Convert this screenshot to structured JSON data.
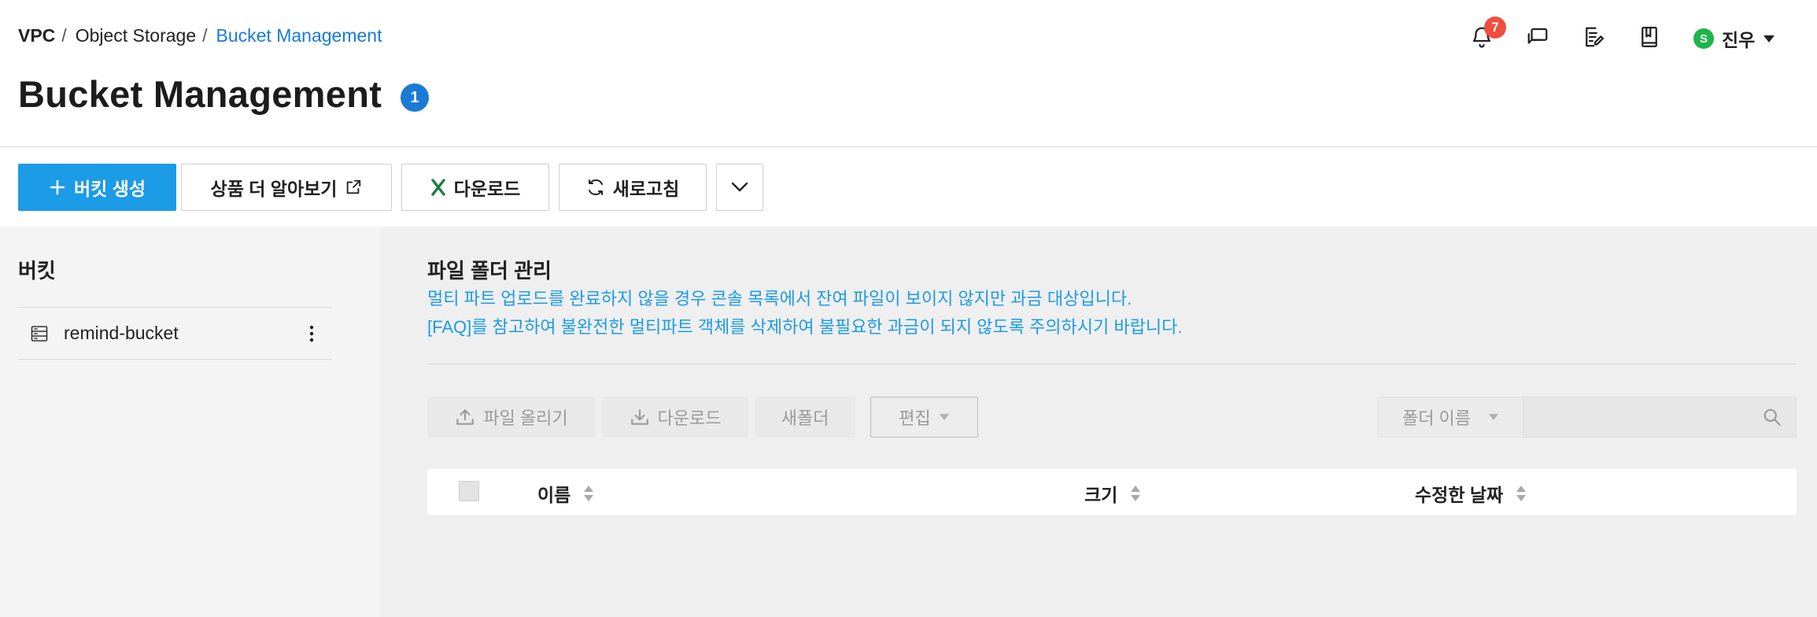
{
  "breadcrumb": {
    "items": [
      "VPC",
      "Object Storage"
    ],
    "separator": "/",
    "current": "Bucket Management"
  },
  "page": {
    "title": "Bucket Management",
    "count_badge": "1"
  },
  "header": {
    "notification_count": "7",
    "icons": [
      "bell-icon",
      "chat-icon",
      "memo-edit-icon",
      "guide-book-icon"
    ],
    "user": {
      "avatar_initial": "S",
      "name": "진우"
    }
  },
  "toolbar": {
    "create_bucket": "버킷 생성",
    "learn_more": "상품 더 알아보기",
    "download": "다운로드",
    "refresh": "새로고침"
  },
  "sidebar": {
    "title": "버킷",
    "buckets": [
      {
        "name": "remind-bucket"
      }
    ]
  },
  "main": {
    "section_title": "파일 폴더 관리",
    "notice_lines": [
      "멀티 파트 업로드를 완료하지 않을 경우 콘솔 목록에서 잔여 파일이 보이지 않지만 과금 대상입니다.",
      "[FAQ]를 참고하여 불완전한 멀티파트 객체를 삭제하여 불필요한 과금이 되지 않도록 주의하시기 바랍니다."
    ],
    "file_toolbar": {
      "upload": "파일 올리기",
      "download": "다운로드",
      "new_folder": "새폴더",
      "edit": "편집"
    },
    "search": {
      "filter_label": "폴더 이름",
      "query": ""
    },
    "table": {
      "columns": [
        "이름",
        "크기",
        "수정한 날짜"
      ]
    }
  },
  "colors": {
    "primary": "#1c9be6",
    "link": "#1a7ad6",
    "badge_red": "#f04e3e",
    "avatar_green": "#1fb54a",
    "excel_green": "#1e7b45"
  }
}
